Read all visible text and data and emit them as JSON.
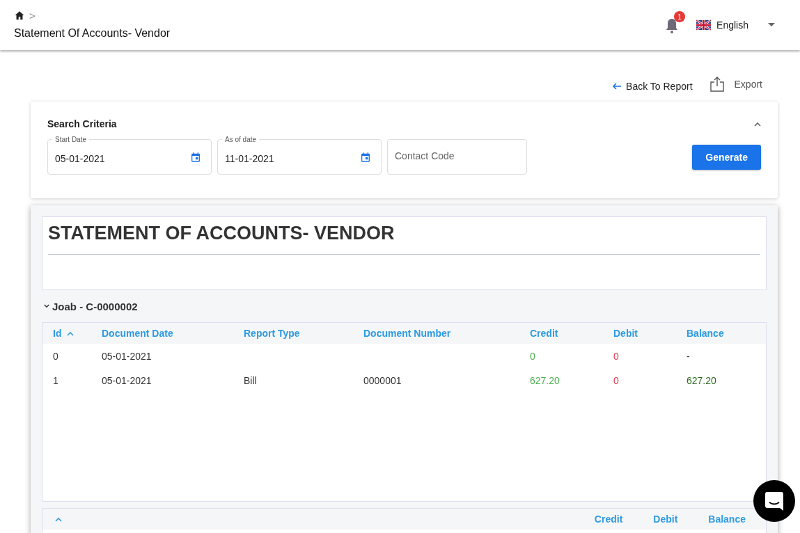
{
  "header": {
    "breadcrumb_separator": ">",
    "title": "Statement Of Accounts- Vendor",
    "notifications": {
      "count": "1"
    },
    "language": "English"
  },
  "actions": {
    "back": "Back To Report",
    "export": "Export"
  },
  "search": {
    "title": "Search Criteria",
    "expanded": true,
    "fields": [
      {
        "label": "Start Date",
        "value": "05-01-2021",
        "kind": "date"
      },
      {
        "label": "As of date",
        "value": "11-01-2021",
        "kind": "date"
      },
      {
        "placeholder": "Contact Code",
        "kind": "text"
      }
    ],
    "button": "Generate"
  },
  "report": {
    "title": "STATEMENT OF ACCOUNTS- VENDOR",
    "groups": [
      {
        "name": "Joab - C-0000002",
        "expanded": true,
        "columns": [
          {
            "label": "Id",
            "sorted": true
          },
          {
            "label": "Document Date",
            "sorted": false
          },
          {
            "label": "Report Type",
            "sorted": false
          },
          {
            "label": "Document Number",
            "sorted": false
          },
          {
            "label": "Credit",
            "sorted": false
          },
          {
            "label": "Debit",
            "sorted": false
          },
          {
            "label": "Balance",
            "sorted": false
          }
        ],
        "rows": [
          [
            {
              "text": "0"
            },
            {
              "text": "05-01-2021"
            },
            {
              "text": ""
            },
            {
              "text": ""
            },
            {
              "text": "0",
              "color": "#4caf50"
            },
            {
              "text": "0",
              "color": "#e53950"
            },
            {
              "text": "-"
            }
          ],
          [
            {
              "text": "1"
            },
            {
              "text": "05-01-2021"
            },
            {
              "text": "Bill"
            },
            {
              "text": "0000001"
            },
            {
              "text": "627.20",
              "color": "#4caf50"
            },
            {
              "text": "0",
              "color": "#e53950"
            },
            {
              "text": "627.20",
              "color": "#2e6b1f"
            }
          ]
        ]
      }
    ],
    "summary": {
      "sorted": true,
      "columns": [
        "Credit",
        "Debit",
        "Balance"
      ]
    }
  }
}
